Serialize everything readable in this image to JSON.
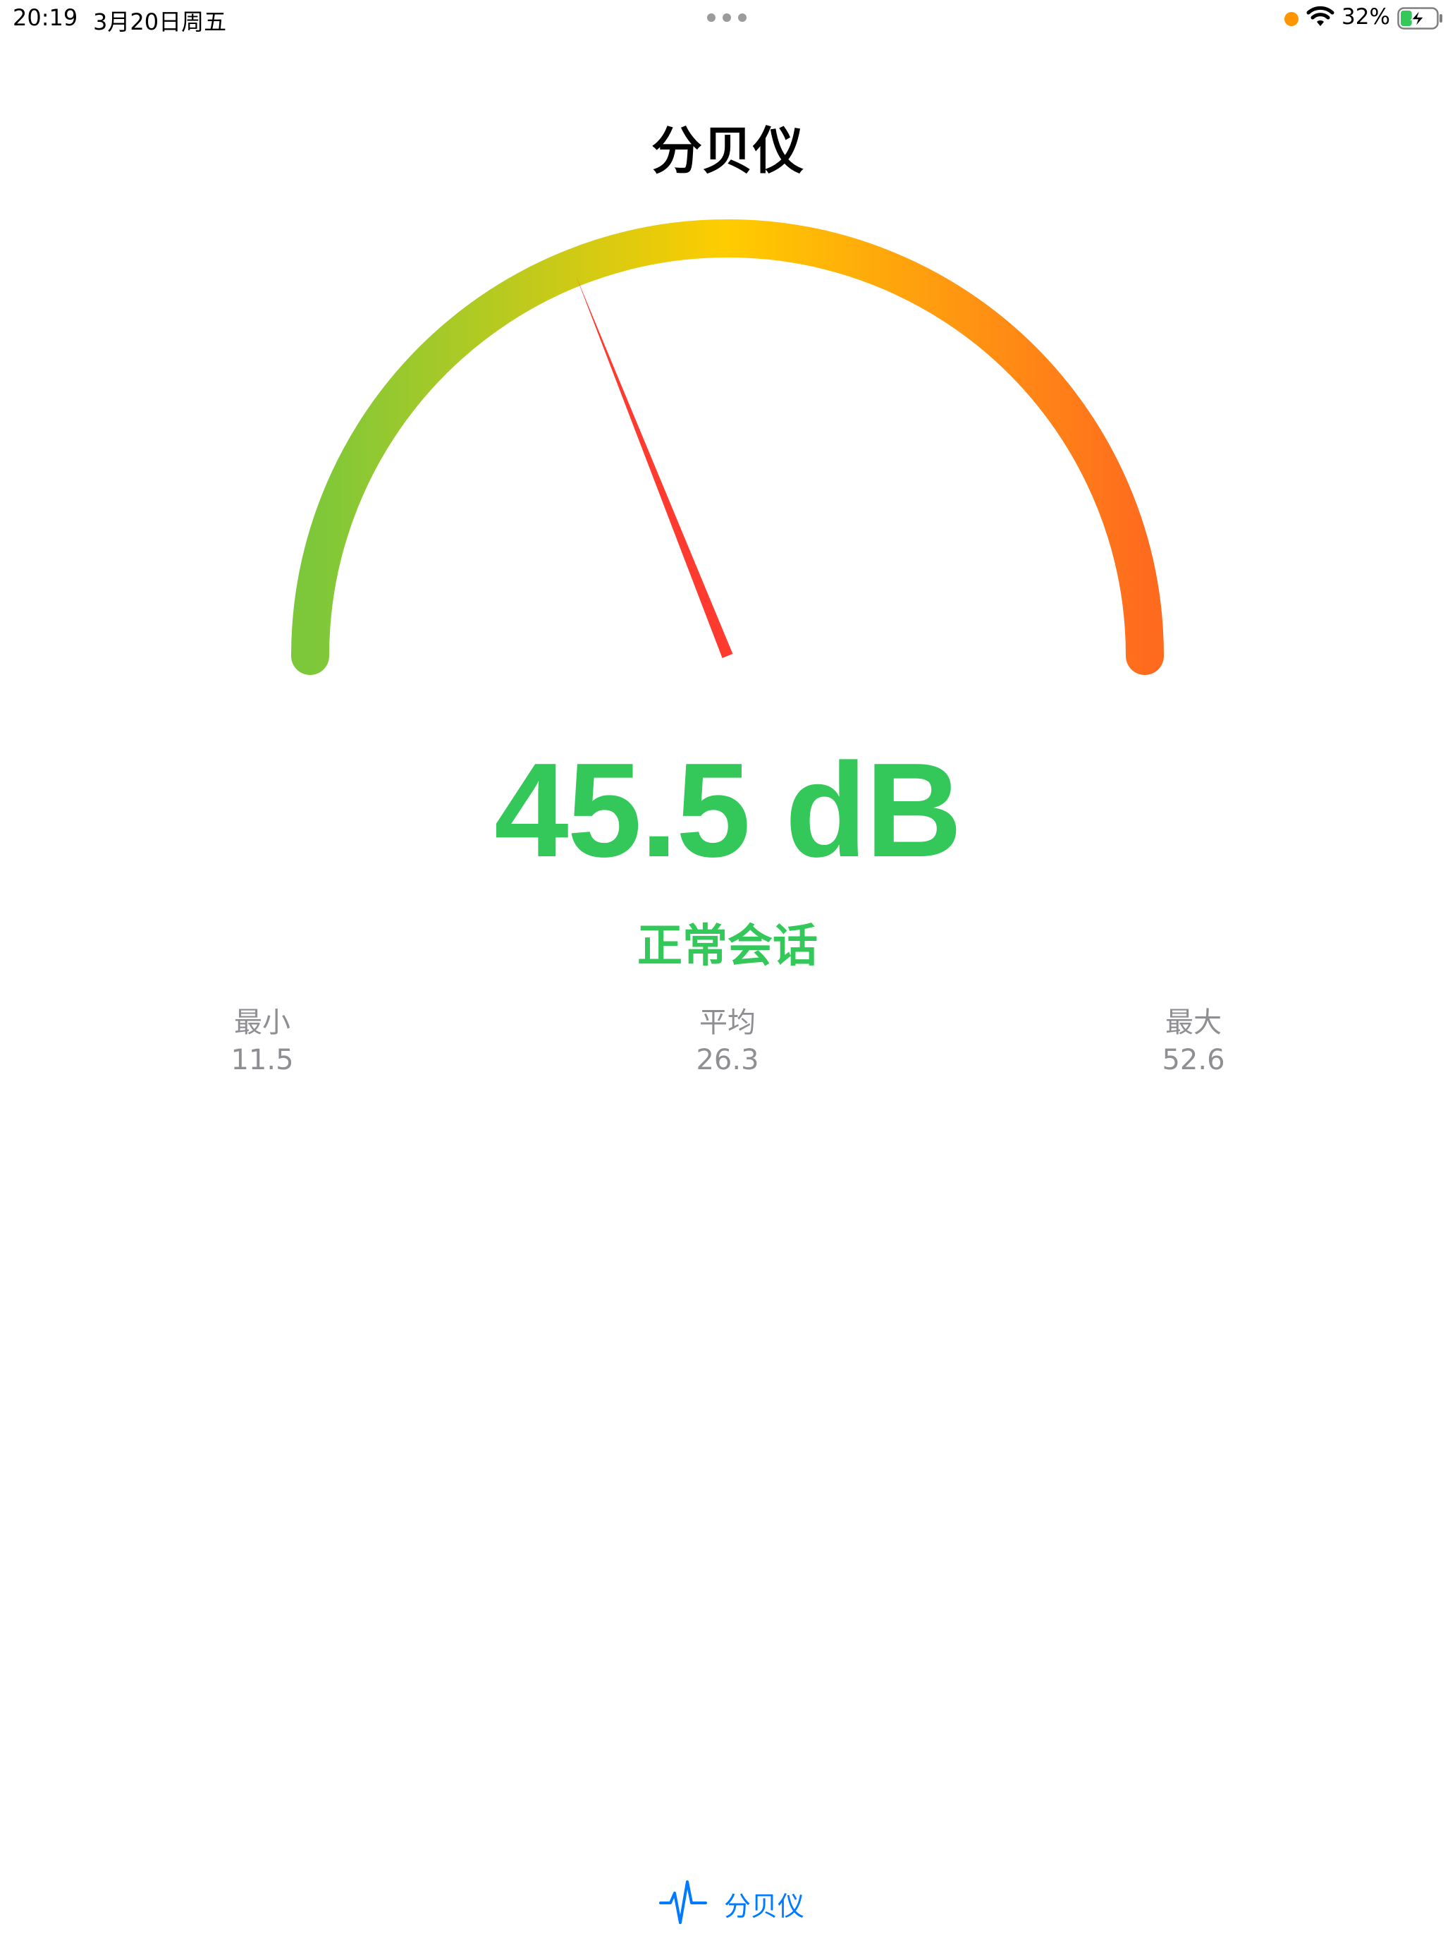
{
  "status_bar": {
    "time": "20:19",
    "date": "3月20日周五",
    "battery_percent": "32%",
    "battery_level": 0.32,
    "recording_dot_color": "#ff9500"
  },
  "header": {
    "title": "分贝仪"
  },
  "meter": {
    "reading": "45.5 dB",
    "value_db": 45.5,
    "scale_min_db": 0,
    "scale_max_db": 120,
    "level_label": "正常会话",
    "reading_color": "#34c759",
    "needle_color": "#ff3b30",
    "arc_colors": [
      "#7cc83a",
      "#ffcc00",
      "#ff6b1e"
    ]
  },
  "stats": {
    "min_label": "最小",
    "min_value": "11.5",
    "avg_label": "平均",
    "avg_value": "26.3",
    "max_label": "最大",
    "max_value": "52.6"
  },
  "tab_bar": {
    "items": [
      {
        "label": "分贝仪",
        "icon": "waveform-icon",
        "selected": true
      }
    ],
    "accent_color": "#007aff"
  }
}
